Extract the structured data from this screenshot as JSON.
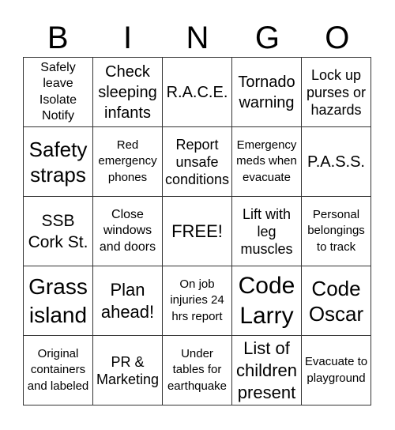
{
  "header": {
    "letters": [
      "B",
      "I",
      "N",
      "G",
      "O"
    ]
  },
  "cells": [
    [
      "Safely leave Isolate Notify",
      "Check sleeping infants",
      "R.A.C.E.",
      "Tornado warning",
      "Lock up purses or hazards"
    ],
    [
      "Safety straps",
      "Red emergency phones",
      "Report unsafe conditions",
      "Emergency meds when evacuate",
      "P.A.S.S."
    ],
    [
      "SSB Cork St.",
      "Close windows and doors",
      "FREE!",
      "Lift with leg muscles",
      "Personal belongings to track"
    ],
    [
      "Grass island",
      "Plan ahead!",
      "On job injuries 24 hrs report",
      "Code Larry",
      "Code Oscar"
    ],
    [
      "Original containers and labeled",
      "PR & Marketing",
      "Under tables for earthquake",
      "List of children present",
      "Evacuate to playground"
    ]
  ]
}
